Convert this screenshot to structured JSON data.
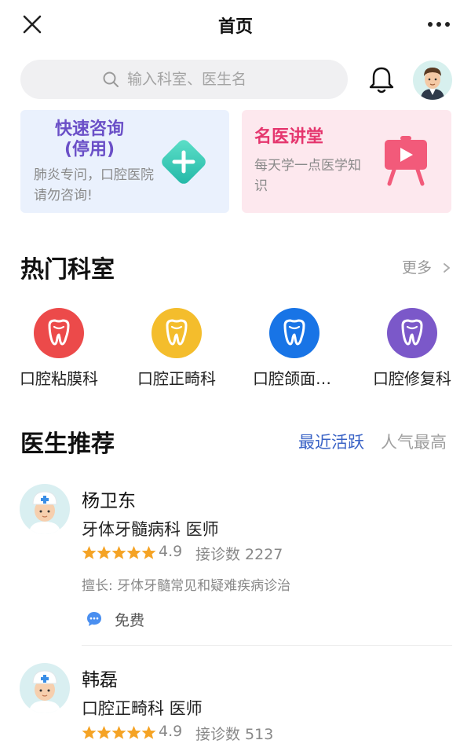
{
  "header": {
    "title": "首页"
  },
  "search": {
    "placeholder": "输入科室、医生名"
  },
  "promos": [
    {
      "title": "快速咨询\n(停用)",
      "desc": "肺炎专问，口腔医院请勿咨询!",
      "color": "#6a4fc7"
    },
    {
      "title": "名医讲堂",
      "desc": "每天学一点医学知识",
      "color": "#e5366e"
    }
  ],
  "departments": {
    "title": "热门科室",
    "more_label": "更多",
    "items": [
      {
        "label": "口腔粘膜科",
        "color": "#ec4a4a",
        "icon": "tooth-icon"
      },
      {
        "label": "口腔正畸科",
        "color": "#f4bd2c",
        "icon": "tooth-icon"
      },
      {
        "label": "口腔颌面外科",
        "color": "#1874e6",
        "icon": "tooth-icon"
      },
      {
        "label": "口腔修复科",
        "color": "#7b58c9",
        "icon": "tooth-icon"
      }
    ]
  },
  "doctors": {
    "title": "医生推荐",
    "tabs": [
      {
        "label": "最近活跃",
        "active": true
      },
      {
        "label": "人气最高",
        "active": false
      }
    ],
    "list": [
      {
        "name": "杨卫东",
        "dept": "牙体牙髓病科  医师",
        "rating": "4.9",
        "consult": "接诊数 2227",
        "specialty": "擅长: 牙体牙髓常见和疑难疾病诊治",
        "fee": "免费"
      },
      {
        "name": "韩磊",
        "dept": "口腔正畸科  医师",
        "rating": "4.9",
        "consult": "接诊数 513"
      }
    ]
  },
  "colors": {
    "accent": "#3a63c6",
    "star": "#f5a324",
    "muted": "#999999"
  }
}
